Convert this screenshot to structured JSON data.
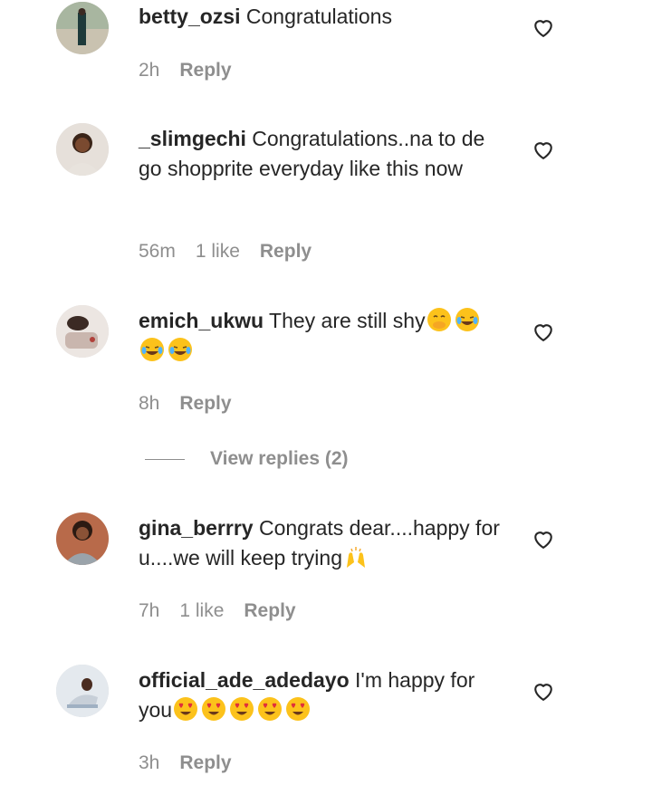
{
  "comments": [
    {
      "username": "betty_ozsi",
      "text": "Congratulations",
      "time": "2h",
      "likes": "",
      "reply_label": "Reply"
    },
    {
      "username": "_slimgechi",
      "text": "Congratulations..na to de go shopprite everyday like this now",
      "time": "56m",
      "likes": "1 like",
      "reply_label": "Reply"
    },
    {
      "username": "emich_ukwu",
      "text": "They are still shy",
      "emojis": [
        "face-with-hand-over-mouth",
        "tears-of-joy",
        "tears-of-joy",
        "tears-of-joy"
      ],
      "time": "8h",
      "likes": "",
      "reply_label": "Reply"
    },
    {
      "username": "gina_berrry",
      "text": "Congrats dear....happy for u....we will keep trying",
      "emojis": [
        "raising-hands"
      ],
      "time": "7h",
      "likes": "1 like",
      "reply_label": "Reply"
    },
    {
      "username": "official_ade_adedayo",
      "text": "I'm happy for you",
      "emojis": [
        "heart-eyes",
        "heart-eyes",
        "heart-eyes",
        "heart-eyes",
        "heart-eyes"
      ],
      "time": "3h",
      "likes": "",
      "reply_label": "Reply"
    }
  ],
  "view_replies": {
    "label": "View replies (2)"
  },
  "icons": {
    "like": "heart-outline-icon"
  },
  "colors": {
    "text": "#262626",
    "secondary": "#8e8e8e",
    "background": "#ffffff"
  }
}
